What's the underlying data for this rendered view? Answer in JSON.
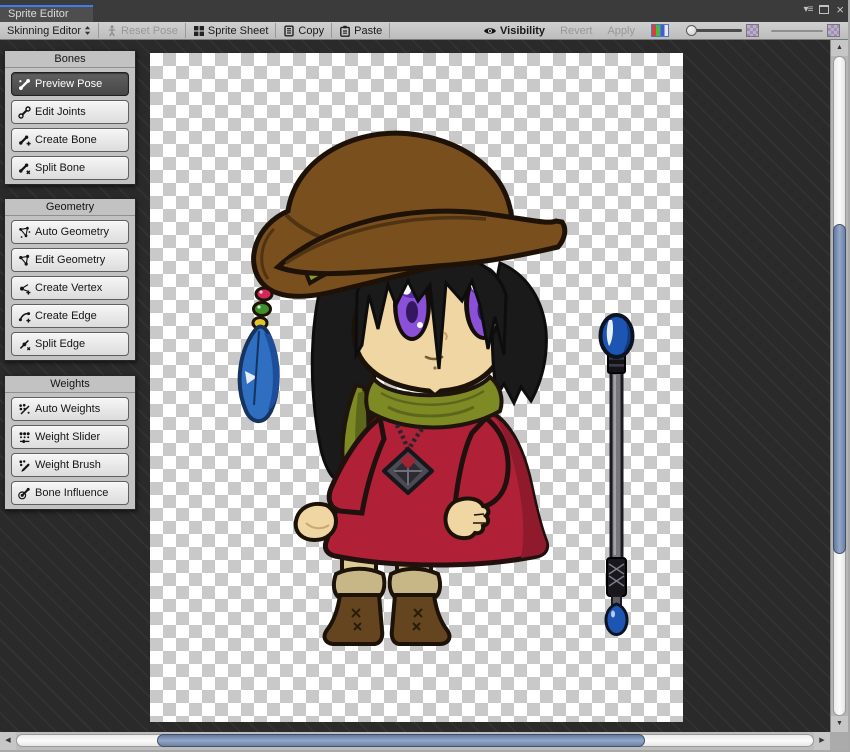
{
  "window": {
    "tab_title": "Sprite Editor"
  },
  "icons": {
    "window_menu": "▾≡",
    "close": "×",
    "scroll_up": "▲",
    "scroll_down": "▼",
    "scroll_left": "◀",
    "scroll_right": "▶"
  },
  "toolbar": {
    "mode_dropdown": "Skinning Editor",
    "reset_pose": "Reset Pose",
    "sprite_sheet": "Sprite Sheet",
    "copy": "Copy",
    "paste": "Paste",
    "visibility": "Visibility",
    "revert": "Revert",
    "apply": "Apply"
  },
  "panels": {
    "bones": {
      "title": "Bones",
      "buttons": [
        {
          "label": "Preview Pose",
          "active": true
        },
        {
          "label": "Edit Joints",
          "active": false
        },
        {
          "label": "Create Bone",
          "active": false
        },
        {
          "label": "Split Bone",
          "active": false
        }
      ]
    },
    "geometry": {
      "title": "Geometry",
      "buttons": [
        {
          "label": "Auto Geometry",
          "active": false
        },
        {
          "label": "Edit Geometry",
          "active": false
        },
        {
          "label": "Create Vertex",
          "active": false
        },
        {
          "label": "Create Edge",
          "active": false
        },
        {
          "label": "Split Edge",
          "active": false
        }
      ]
    },
    "weights": {
      "title": "Weights",
      "buttons": [
        {
          "label": "Auto Weights",
          "active": false
        },
        {
          "label": "Weight Slider",
          "active": false
        },
        {
          "label": "Weight Brush",
          "active": false
        },
        {
          "label": "Bone Influence",
          "active": false
        }
      ]
    }
  },
  "canvas": {
    "sprite_description": "Chibi witch character sprite with brown floppy hat, black hair, purple eyes, green scarf, red dress, brown boots, hat beads with blue feather, and a staff with blue orbs",
    "palette": {
      "hat": "#7a4f1e",
      "hat_shade": "#4f3312",
      "hat_band": "#8e9b25",
      "hair": "#1a1a1a",
      "skin": "#f0d6a2",
      "eyes": "#8a50d8",
      "scarf": "#7e8b25",
      "dress": "#b02138",
      "dress_shade": "#8e1a2c",
      "leggings": "#dccb96",
      "boot_fur": "#c8b786",
      "boots": "#64451f",
      "staff_orb": "#1d55b2",
      "staff_rod": "#77777c",
      "feather": "#2f6fc1",
      "bead_1": "#d6275b",
      "bead_2": "#3f8f2b",
      "bead_3": "#e5c526",
      "pendant": "#4b4b54"
    }
  },
  "colors": {
    "tab_accent": "#3d7ee8",
    "canvas_bg": "#2a2a2a",
    "checker_light": "#ffffff",
    "checker_dark": "#c9c9c9",
    "scroll_thumb": "#7e94bc",
    "toolbar_bg": "#c6c6c6",
    "panel_bg": "#c2c2c2"
  }
}
